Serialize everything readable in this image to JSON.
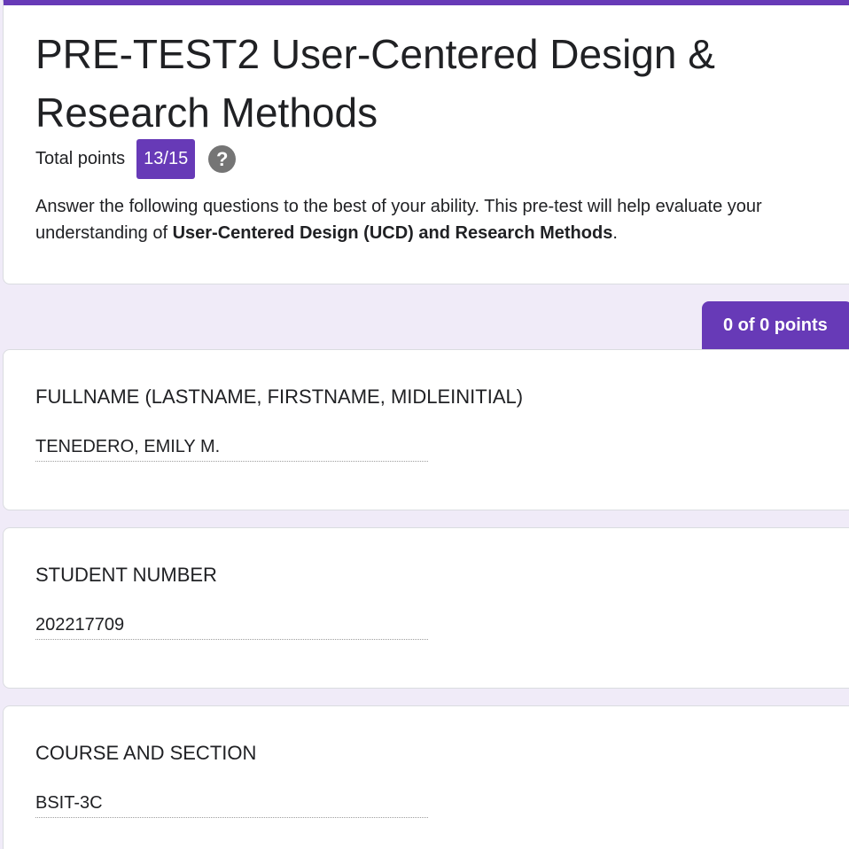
{
  "form": {
    "title": "PRE-TEST2 User-Centered Design & Research Methods",
    "total_points_label": "Total points",
    "score": "13/15",
    "help_icon": "help-circle-icon",
    "description_before": " Answer the following questions to the best of your ability. This pre-test will help evaluate your understanding of ",
    "description_bold": "User-Centered Design (UCD) and Research Methods",
    "description_after": "."
  },
  "section": {
    "points": "0 of 0 points"
  },
  "questions": [
    {
      "title": "FULLNAME (LASTNAME, FIRSTNAME, MIDLEINITIAL)",
      "answer": "TENEDERO, EMILY M."
    },
    {
      "title": "STUDENT NUMBER",
      "answer": "202217709"
    },
    {
      "title": "COURSE AND SECTION",
      "answer": "BSIT-3C"
    }
  ],
  "colors": {
    "accent": "#673ab7",
    "background": "#f0ebf8",
    "card": "#ffffff",
    "help_icon": "#757575"
  }
}
